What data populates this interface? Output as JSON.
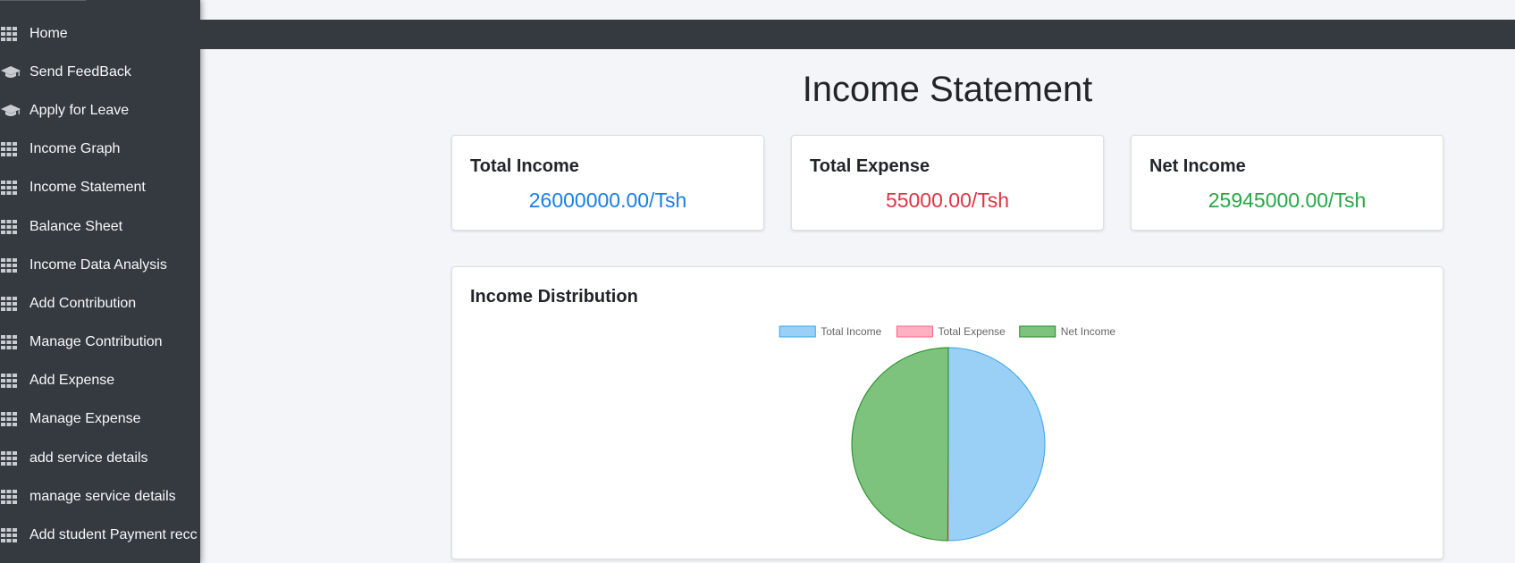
{
  "sidebar": {
    "items": [
      {
        "label": "Home",
        "icon": "grid-icon"
      },
      {
        "label": "Send FeedBack",
        "icon": "graduation-cap-icon"
      },
      {
        "label": "Apply for Leave",
        "icon": "graduation-cap-icon"
      },
      {
        "label": "Income Graph",
        "icon": "grid-icon"
      },
      {
        "label": "Income Statement",
        "icon": "grid-icon"
      },
      {
        "label": "Balance Sheet",
        "icon": "grid-icon"
      },
      {
        "label": "Income Data Analysis",
        "icon": "grid-icon"
      },
      {
        "label": "Add Contribution",
        "icon": "grid-icon"
      },
      {
        "label": "Manage Contribution",
        "icon": "grid-icon"
      },
      {
        "label": "Add Expense",
        "icon": "grid-icon"
      },
      {
        "label": "Manage Expense",
        "icon": "grid-icon"
      },
      {
        "label": "add service details",
        "icon": "grid-icon"
      },
      {
        "label": "manage service details",
        "icon": "grid-icon"
      },
      {
        "label": "Add student Payment recc",
        "icon": "grid-icon"
      }
    ]
  },
  "page": {
    "title": "Income Statement"
  },
  "cards": {
    "income": {
      "title": "Total Income",
      "value": "26000000.00/Tsh",
      "color": "#1a7ee6"
    },
    "expense": {
      "title": "Total Expense",
      "value": "55000.00/Tsh",
      "color": "#dc3545"
    },
    "net": {
      "title": "Net Income",
      "value": "25945000.00/Tsh",
      "color": "#28a745"
    }
  },
  "chart_section": {
    "title": "Income Distribution"
  },
  "chart_data": {
    "type": "pie",
    "categories": [
      "Total Income",
      "Total Expense",
      "Net Income"
    ],
    "values": [
      26000000,
      55000,
      25945000
    ],
    "fill_colors": [
      "#9ad0f5",
      "#ffb1c1",
      "#7dc27d"
    ],
    "border_colors": [
      "#36a2eb",
      "#ff6384",
      "#1e8a1e"
    ],
    "legend_position": "top",
    "title": ""
  }
}
